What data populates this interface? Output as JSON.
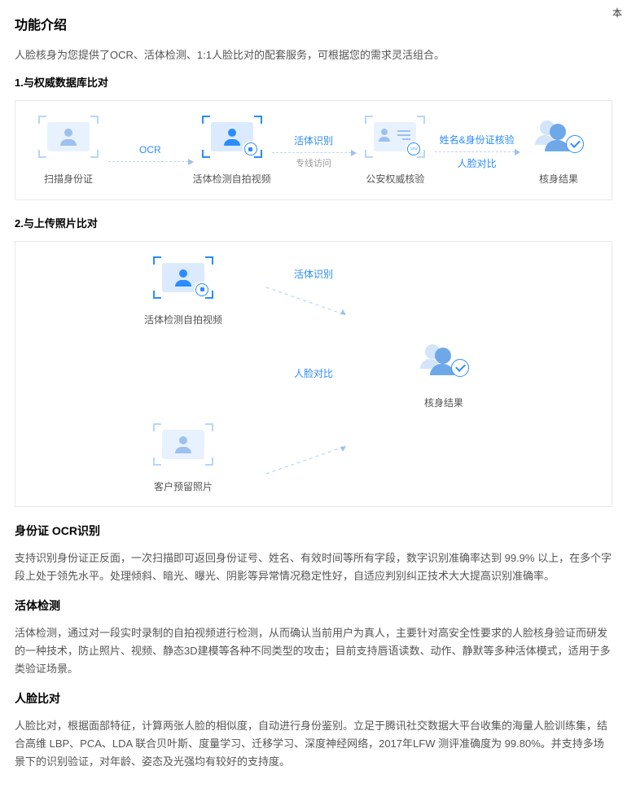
{
  "page": {
    "top_marker": "本"
  },
  "headings": {
    "features": "功能介绍",
    "intro": "人脸核身为您提供了OCR、活体检测、1:1人脸比对的配套服务，可根据您的需求灵活组合。",
    "flow1_title": "1.与权威数据库比对",
    "flow2_title": "2.与上传照片比对"
  },
  "flow1": {
    "steps": {
      "scan": "扫描身份证",
      "selfie": "活体检测自拍视频",
      "police": "公安权威核验",
      "result": "核身结果"
    },
    "arrows": {
      "a1": "OCR",
      "a2_top": "活体识别",
      "a2_sub": "专线访问",
      "a3_top": "姓名&身份证核验",
      "a3_bot": "人脸对比"
    }
  },
  "flow2": {
    "steps": {
      "selfie": "活体检测自拍视频",
      "result": "核身结果",
      "customer": "客户预留照片"
    },
    "arrows": {
      "a_top": "活体识别",
      "a_mid": "人脸对比"
    }
  },
  "sections": {
    "ocr": {
      "title": "身份证 OCR识别",
      "desc": "支持识别身份证正反面，一次扫描即可返回身份证号、姓名、有效时间等所有字段，数字识别准确率达到 99.9% 以上，在多个字段上处于领先水平。处理倾斜、暗光、曝光、阴影等异常情况稳定性好，自适应判别纠正技术大大提高识别准确率。"
    },
    "liveness": {
      "title": "活体检测",
      "desc": "活体检测，通过对一段实时录制的自拍视频进行检测，从而确认当前用户为真人，主要针对高安全性要求的人脸核身验证而研发的一种技术，防止照片、视频、静态3D建模等各种不同类型的攻击；目前支持唇语读数、动作、静默等多种活体模式，适用于多类验证场景。"
    },
    "compare": {
      "title": "人脸比对",
      "desc": "人脸比对，根据面部特征，计算两张人脸的相似度，自动进行身份鉴别。立足于腾讯社交数据大平台收集的海量人脸训练集，结合高维 LBP、PCA、LDA 联合贝叶斯、度量学习、迁移学习、深度神经网络，2017年LFW 测评准确度为 99.80%。并支持多场景下的识别验证，对年龄、姿态及光强均有较好的支持度。"
    }
  }
}
